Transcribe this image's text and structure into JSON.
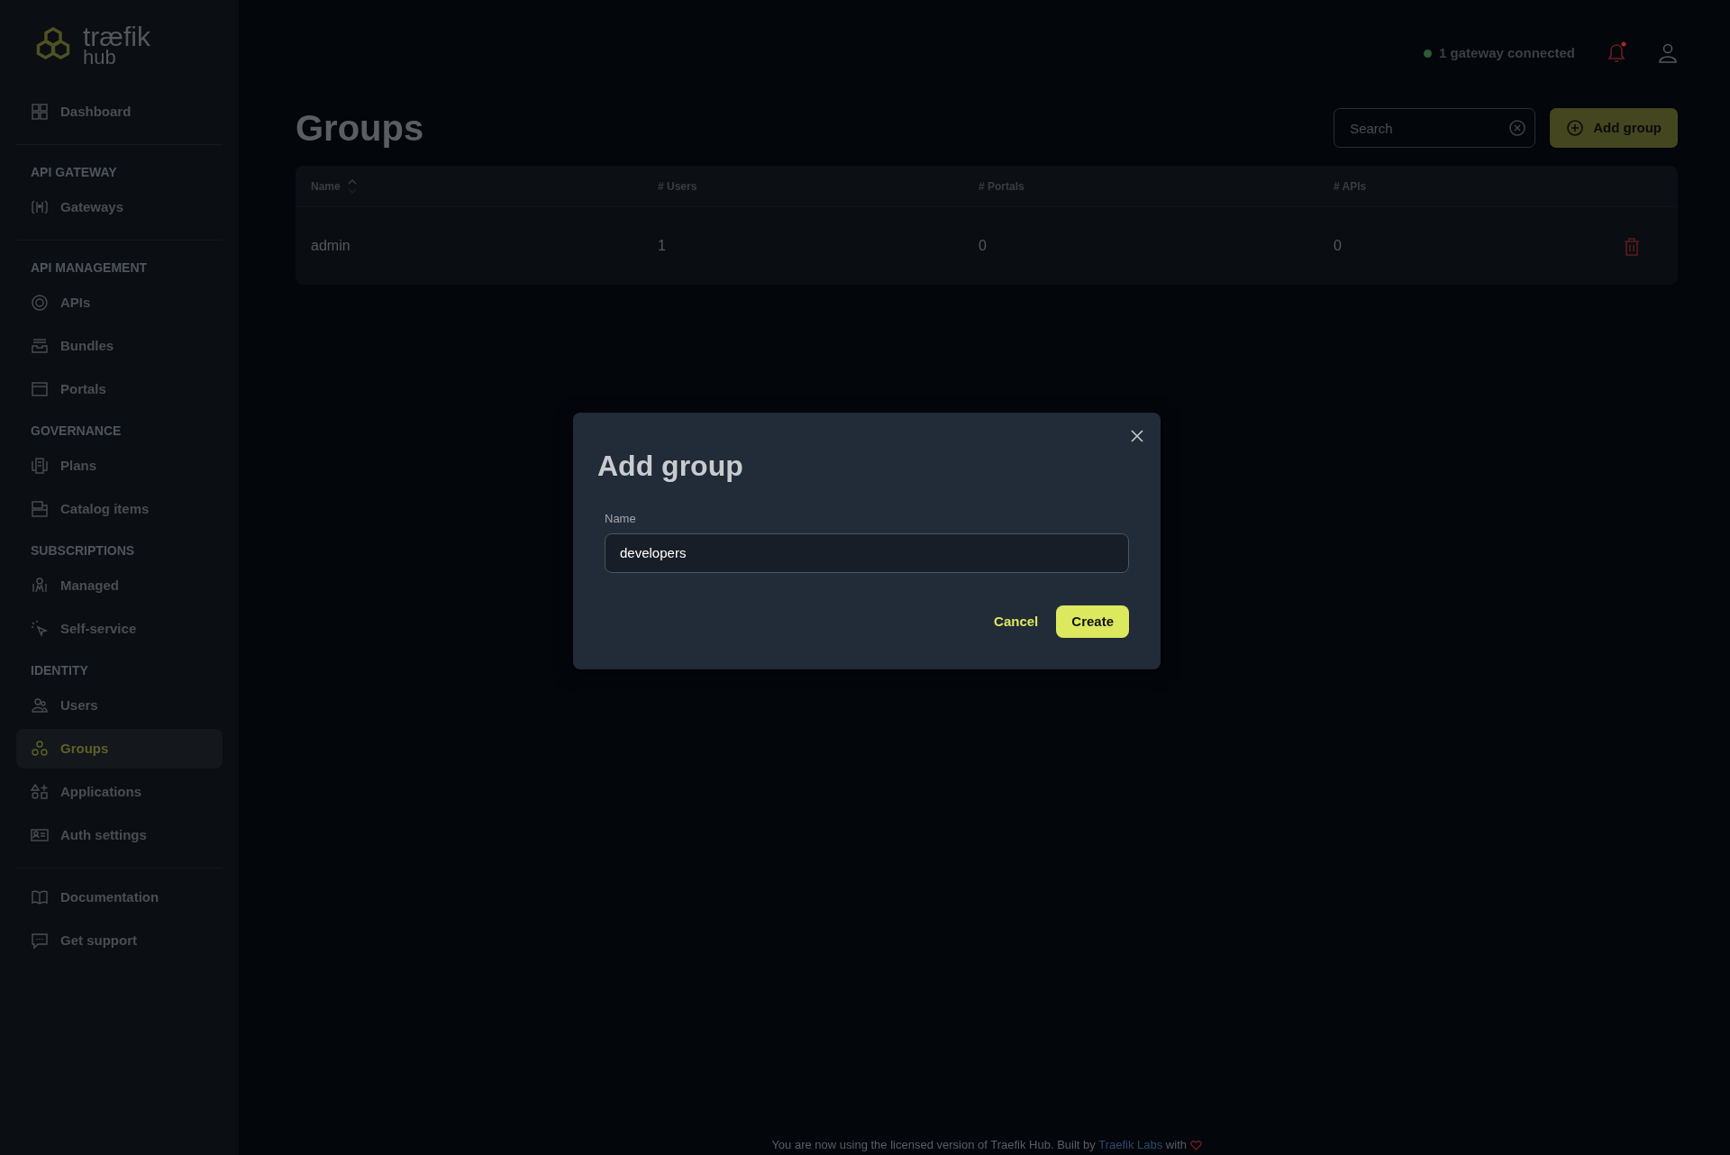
{
  "logo": {
    "word": "træfik",
    "sub": "hub"
  },
  "sidebar": {
    "blocks": [
      {
        "sections": [
          {
            "items": [
              {
                "label": "Dashboard",
                "selected": false
              }
            ]
          }
        ]
      },
      {
        "sections": [
          {
            "heading": "API GATEWAY",
            "items": [
              {
                "label": "Gateways",
                "selected": false
              }
            ]
          }
        ]
      },
      {
        "sections": [
          {
            "heading": "API MANAGEMENT",
            "items": [
              {
                "label": "APIs",
                "selected": false
              },
              {
                "label": "Bundles",
                "selected": false
              },
              {
                "label": "Portals",
                "selected": false
              }
            ]
          },
          {
            "heading": "GOVERNANCE",
            "items": [
              {
                "label": "Plans",
                "selected": false
              },
              {
                "label": "Catalog items",
                "selected": false
              }
            ]
          },
          {
            "heading": "SUBSCRIPTIONS",
            "items": [
              {
                "label": "Managed",
                "selected": false
              },
              {
                "label": "Self-service",
                "selected": false
              }
            ]
          },
          {
            "heading": "IDENTITY",
            "items": [
              {
                "label": "Users",
                "selected": false
              },
              {
                "label": "Groups",
                "selected": true
              },
              {
                "label": "Applications",
                "selected": false
              },
              {
                "label": "Auth settings",
                "selected": false
              }
            ]
          }
        ]
      },
      {
        "sections": [
          {
            "items": [
              {
                "label": "Documentation",
                "selected": false
              },
              {
                "label": "Get support",
                "selected": false
              }
            ]
          }
        ]
      }
    ]
  },
  "header": {
    "status": "1 gateway connected",
    "notification": true
  },
  "page": {
    "title": "Groups",
    "search": {
      "placeholder": "Search"
    },
    "add_button": "Add group"
  },
  "table": {
    "columns": [
      "Name",
      "# Users",
      "# Portals",
      "# APIs"
    ],
    "rows": [
      {
        "cells": [
          "admin",
          "1",
          "0",
          "0"
        ]
      }
    ]
  },
  "modal": {
    "title": "Add group",
    "field_label": "Name",
    "field_value": "developers",
    "cancel": "Cancel",
    "create": "Create"
  },
  "footer": {
    "text": "You are now using the licensed version of Traefik Hub. Built by",
    "link": "Traefik Labs",
    "after": "with"
  }
}
